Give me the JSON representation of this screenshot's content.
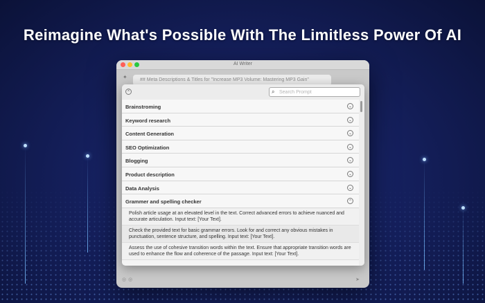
{
  "headline": "Reimagine What's Possible With The Limitless Power Of AI",
  "window": {
    "title": "AI Writer",
    "document_line": "## Meta Descriptions & Titles for \"Increase MP3 Volume: Mastering MP3 Gain\""
  },
  "prompt_panel": {
    "close_icon": "close-circle-icon",
    "search": {
      "placeholder": "Search Prompt",
      "value": ""
    },
    "categories": [
      {
        "label": "Brainstroming",
        "expanded": false
      },
      {
        "label": "Keyword research",
        "expanded": false
      },
      {
        "label": "Content Generation",
        "expanded": false
      },
      {
        "label": "SEO Optimization",
        "expanded": false
      },
      {
        "label": "Blogging",
        "expanded": false
      },
      {
        "label": "Product description",
        "expanded": false
      },
      {
        "label": "Data Analysis",
        "expanded": false
      },
      {
        "label": "Grammer and spelling checker",
        "expanded": true
      }
    ],
    "grammar_prompts": [
      "Polish article usage at an elevated level in the text. Correct advanced errors to achieve nuanced and accurate articulation. Input text: [Your Text].",
      "Check the provided text for basic grammar errors. Look for and correct any obvious mistakes in punctuation, sentence structure, and spelling. Input text: [Your Text].",
      "Assess the use of cohesive transition words within the text. Ensure that appropriate transition words are used to enhance the flow and coherence of the passage. Input text: [Your Text]."
    ]
  },
  "colors": {
    "background": "#15205e",
    "panel": "#f4f4f4",
    "traffic_close": "#fe5f57",
    "traffic_min": "#febc2e",
    "traffic_max": "#28c840"
  }
}
